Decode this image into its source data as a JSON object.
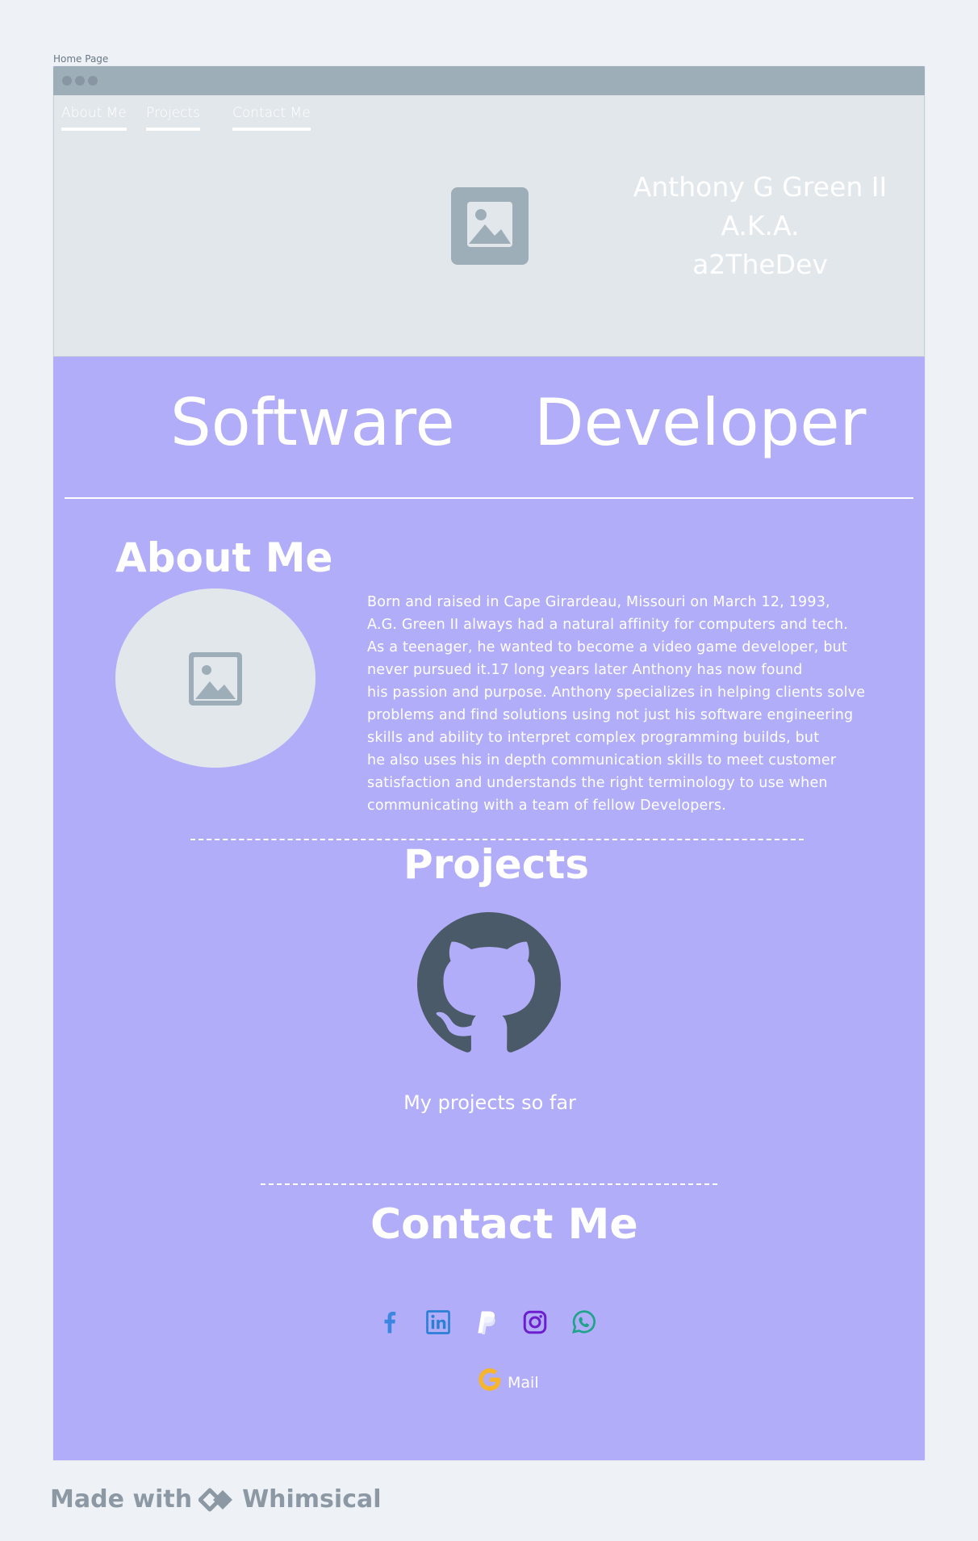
{
  "page_label": "Home Page",
  "nav": {
    "items": [
      {
        "label": "About Me"
      },
      {
        "label": "Projects"
      },
      {
        "label": "Contact Me"
      }
    ]
  },
  "hero": {
    "name_lines": [
      "Anthony G Green II",
      "A.K.A.",
      "a2TheDev"
    ],
    "image_icon": "image-placeholder-icon"
  },
  "headline": {
    "word1": "Software",
    "word2": "Developer"
  },
  "about": {
    "title": "About Me",
    "image_icon": "image-placeholder-icon",
    "bio_lines": [
      "Born and raised in Cape Girardeau, Missouri on March 12, 1993,",
      "A.G. Green II always had a natural affinity for computers and tech.",
      "As a teenager, he wanted to become a video game developer, but",
      "never pursued it.17 long years later Anthony has now found",
      "his passion and purpose. Anthony specializes in helping clients solve",
      "problems and find solutions using not just his software engineering",
      "skills and ability to interpret complex programming builds, but",
      "he also uses his in depth communication skills to meet customer",
      "satisfaction and understands the right terminology to use when",
      "communicating with a team of fellow Developers."
    ]
  },
  "projects": {
    "title": "Projects",
    "icon": "github-icon",
    "caption": "My projects so far"
  },
  "contact": {
    "title": "Contact Me",
    "socials": [
      {
        "icon": "facebook-icon",
        "color": "#3b86e0"
      },
      {
        "icon": "linkedin-icon",
        "color": "#2c7fd8"
      },
      {
        "icon": "paypal-icon",
        "color": "#ffffff"
      },
      {
        "icon": "instagram-icon",
        "color": "#6d1fd0"
      },
      {
        "icon": "whatsapp-icon",
        "color": "#1fa38a"
      }
    ],
    "mail": {
      "icon": "google-icon",
      "label": "Mail",
      "color": "#f6b52a"
    }
  },
  "footer": {
    "made_with": "Made with",
    "brand": "Whimsical"
  },
  "colors": {
    "page_bg": "#eef2f6",
    "frame_bg": "#b2adf9",
    "header_bg": "#e2e7ec",
    "placeholder": "#9eaeb9",
    "github": "#4b5a68"
  }
}
